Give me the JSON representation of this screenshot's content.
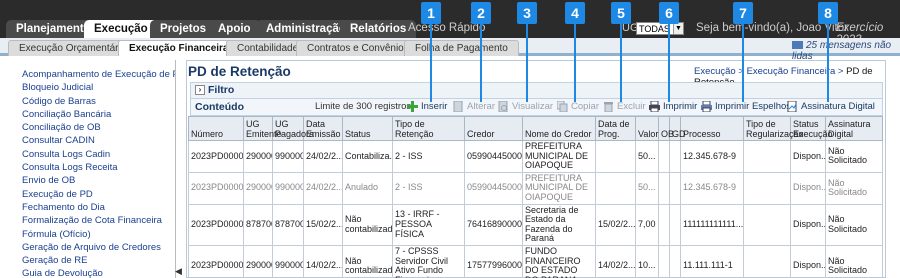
{
  "topnav": {
    "tabs": [
      "Planejamento",
      "Execução",
      "Projetos",
      "Apoio",
      "Administração",
      "Relatórios"
    ],
    "quick_access": "Acesso Rápido",
    "ug_label": "UG",
    "ug_value": "TODAS",
    "welcome": "Seja bem-vindo(a), Joao Vitor",
    "exercise": "Exercício 2023"
  },
  "subnav": {
    "tabs": [
      "Execução Orçamentária",
      "Execução Financeira",
      "Contabilidade",
      "Contratos e Convênios",
      "Folha de Pagamento"
    ],
    "messages": "25 mensagens não lidas"
  },
  "sidebar": {
    "items": [
      "Acompanhamento de Execução de PD",
      "Bloqueio Judicial",
      "Código de Barras",
      "Conciliação Bancária",
      "Conciliação de OB",
      "Consultar CADIN",
      "Consulta Logs Cadin",
      "Consulta Logs Receita",
      "Envio de OB",
      "Execução de PD",
      "Fechamento do Dia",
      "Formalização de Cota Financeira",
      "Fórmula (Ofício)",
      "Geração de Arquivo de Credores",
      "Geração de RE",
      "Guia de Devolução"
    ]
  },
  "page": {
    "title": "PD de Retenção",
    "breadcrumb": [
      "Execução",
      "Execução Financeira",
      "PD de Retenção"
    ],
    "filter_label": "Filtro",
    "content_label": "Conteúdo",
    "limit_text": "Limite de 300 registros."
  },
  "toolbar": {
    "buttons": [
      "Inserir",
      "Alterar",
      "Visualizar",
      "Copiar",
      "Excluir",
      "Imprimir",
      "Imprimir Espelhos",
      "Assinatura Digital"
    ]
  },
  "callouts": [
    "1",
    "2",
    "3",
    "4",
    "5",
    "6",
    "7",
    "8"
  ],
  "table": {
    "headers": [
      "Número",
      "UG Emitente",
      "UG Pagadora",
      "Data Emissão",
      "Status",
      "Tipo de Retenção",
      "Credor",
      "Nome do Credor",
      "Data de Prog.",
      "Valor",
      "OB",
      "GD",
      "Processo",
      "Tipo de Regularização",
      "Status Execução",
      "Assinatura Digital"
    ],
    "rows": [
      [
        "2023PD0000...",
        "290000",
        "990000",
        "24/02/2...",
        "Contabiliza...",
        "2 - ISS",
        "05990445000...",
        "PREFEITURA MUNICIPAL DE OIAPOQUE",
        "",
        "50...",
        "",
        "",
        "12.345.678-9",
        "",
        "Dispon...",
        "Não Solicitado"
      ],
      [
        "2023PD0000...",
        "290000",
        "990000",
        "24/02/2...",
        "Anulado",
        "2 - ISS",
        "05990445000...",
        "PREFEITURA MUNICIPAL DE OIAPOQUE",
        "",
        "50...",
        "",
        "",
        "12.345.678-9",
        "",
        "Dispon...",
        "Não Solicitado"
      ],
      [
        "2023PD0000...",
        "878700",
        "878700",
        "15/02/2...",
        "Não contabilizado",
        "13 - IRRF - PESSOA FÍSICA",
        "76416890000...",
        "Secretaria de Estado da Fazenda do Paraná",
        "15/02/2...",
        "7,00",
        "",
        "",
        "111111111111...",
        "",
        "Dispon...",
        "Não Solicitado"
      ],
      [
        "2023PD0000...",
        "290000",
        "990000",
        "14/02/2...",
        "Não contabilizado",
        "7 - CPSSS Servidor Civil Ativo Fundo Financeiro",
        "17577996000...",
        "FUNDO FINANCEIRO DO ESTADO DO PARANA",
        "14/02/2...",
        "10...",
        "",
        "",
        "11.111.111-1",
        "",
        "Dispon...",
        "Não Solicitado"
      ]
    ]
  },
  "colors": {
    "topbar": "#2b2b2b",
    "accent_blue": "#1e88e5",
    "link": "#1a3f8f",
    "title": "#1a3a66"
  }
}
